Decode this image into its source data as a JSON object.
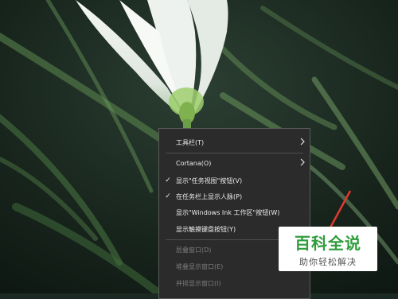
{
  "menu": {
    "items": [
      {
        "label": "工具栏(T)",
        "checked": false,
        "submenu": true,
        "enabled": true
      },
      {
        "label": "Cortana(O)",
        "checked": false,
        "submenu": true,
        "enabled": true
      },
      {
        "label": "显示\"任务视图\"按钮(V)",
        "checked": true,
        "submenu": false,
        "enabled": true
      },
      {
        "label": "在任务栏上显示人脉(P)",
        "checked": true,
        "submenu": false,
        "enabled": true
      },
      {
        "label": "显示\"Windows Ink 工作区\"按钮(W)",
        "checked": false,
        "submenu": false,
        "enabled": true
      },
      {
        "label": "显示触摸键盘按钮(Y)",
        "checked": false,
        "submenu": false,
        "enabled": true
      },
      {
        "label": "层叠窗口(D)",
        "checked": false,
        "submenu": false,
        "enabled": false
      },
      {
        "label": "堆叠显示窗口(E)",
        "checked": false,
        "submenu": false,
        "enabled": false
      },
      {
        "label": "并排显示窗口(I)",
        "checked": false,
        "submenu": false,
        "enabled": false
      }
    ],
    "check_glyph": "✓",
    "arrow_icon": "chevron-right-icon"
  },
  "watermark": {
    "title": "百科全说",
    "subtitle": "助你轻松解决",
    "color": "#2f9d3b"
  },
  "colors": {
    "menu_bg": "#2b2b2b",
    "menu_border": "#5a5a5a",
    "disabled_text": "#7c7c7c",
    "accent_line": "#e03a2e"
  }
}
